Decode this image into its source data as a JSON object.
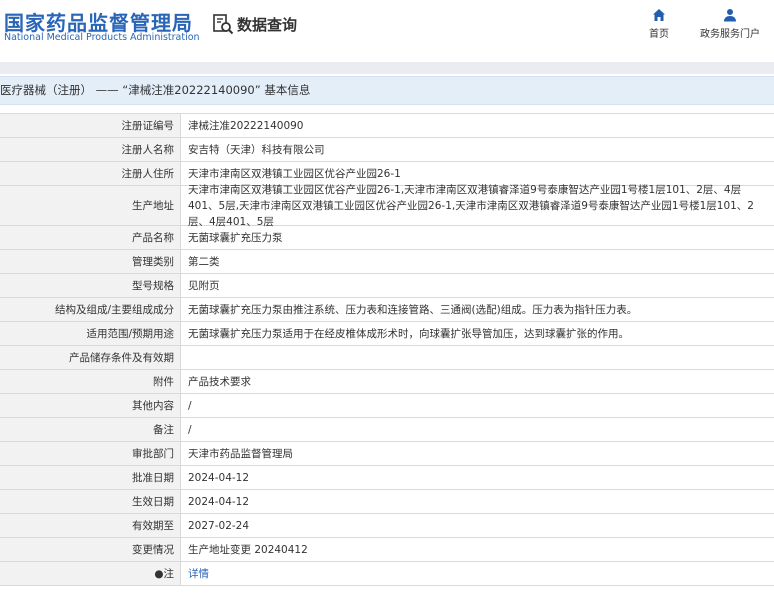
{
  "header": {
    "org_cn": "国家药品监督管理局",
    "org_en": "National Medical Products Administration",
    "query_label": "数据查询",
    "nav_home": "首页",
    "nav_service": "政务服务门户"
  },
  "breadcrumb": "医疗器械（注册） —— “津械注准20222140090” 基本信息",
  "rows": [
    {
      "label": "注册证编号",
      "value": "津械注准20222140090"
    },
    {
      "label": "注册人名称",
      "value": "安吉特（天津）科技有限公司"
    },
    {
      "label": "注册人住所",
      "value": "天津市津南区双港镇工业园区优谷产业园26-1"
    },
    {
      "label": "生产地址",
      "value": "天津市津南区双港镇工业园区优谷产业园26-1,天津市津南区双港镇睿泽道9号泰康智达产业园1号楼1层101、2层、4层401、5层,天津市津南区双港镇工业园区优谷产业园26-1,天津市津南区双港镇睿泽道9号泰康智达产业园1号楼1层101、2层、4层401、5层"
    },
    {
      "label": "产品名称",
      "value": "无菌球囊扩充压力泵"
    },
    {
      "label": "管理类别",
      "value": "第二类"
    },
    {
      "label": "型号规格",
      "value": "见附页"
    },
    {
      "label": "结构及组成/主要组成成分",
      "value": "无菌球囊扩充压力泵由推注系统、压力表和连接管路、三通阀(选配)组成。压力表为指针压力表。"
    },
    {
      "label": "适用范围/预期用途",
      "value": "无菌球囊扩充压力泵适用于在经皮椎体成形术时，向球囊扩张导管加压，达到球囊扩张的作用。"
    },
    {
      "label": "产品储存条件及有效期",
      "value": ""
    },
    {
      "label": "附件",
      "value": "产品技术要求"
    },
    {
      "label": "其他内容",
      "value": "/"
    },
    {
      "label": "备注",
      "value": "/"
    },
    {
      "label": "审批部门",
      "value": "天津市药品监督管理局"
    },
    {
      "label": "批准日期",
      "value": "2024-04-12"
    },
    {
      "label": "生效日期",
      "value": "2024-04-12"
    },
    {
      "label": "有效期至",
      "value": "2027-02-24"
    },
    {
      "label": "变更情况",
      "value": "生产地址变更 20240412"
    },
    {
      "label": "●注",
      "value": "详情"
    }
  ]
}
